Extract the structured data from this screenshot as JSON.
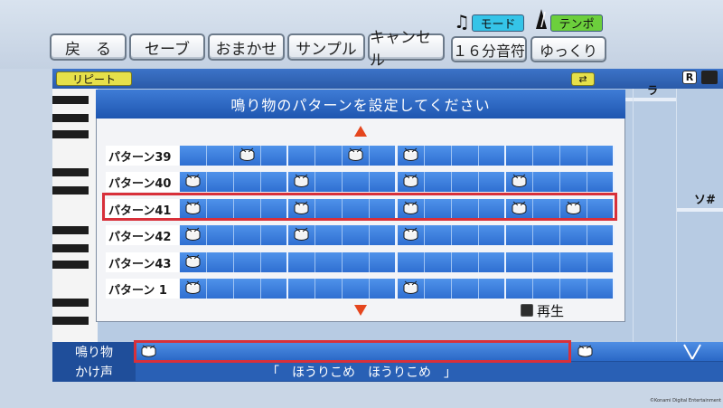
{
  "toolbar": {
    "back": "戻　る",
    "save": "セーブ",
    "omakase": "おまかせ",
    "sample": "サンプル",
    "cancel": "キャンセル",
    "note_length": "１６分音符",
    "speed": "ゆっくり",
    "mode_label": "モード",
    "tempo_label": "テンポ",
    "mode_icon": "music-note-icon",
    "tempo_icon": "metronome-icon"
  },
  "editor": {
    "repeat_label": "リピート",
    "loop_icon": "loop-icon",
    "r_badge": "R",
    "note_ra": "ラ",
    "note_sos": "ソ#"
  },
  "dialog": {
    "title": "鳴り物のパターンを設定してください",
    "play_label": "再生",
    "rows": [
      {
        "label": "パターン39",
        "beats": [
          2,
          6,
          8
        ]
      },
      {
        "label": "パターン40",
        "beats": [
          0,
          4,
          8,
          12
        ]
      },
      {
        "label": "パターン41",
        "beats": [
          0,
          4,
          8,
          12,
          14
        ],
        "selected": true
      },
      {
        "label": "パターン42",
        "beats": [
          0,
          4,
          8
        ]
      },
      {
        "label": "パターン43",
        "beats": [
          0
        ]
      },
      {
        "label": "パターン 1",
        "beats": [
          0,
          8
        ]
      }
    ],
    "columns": 16
  },
  "tracks": {
    "narimono_label": "鳴り物",
    "kakegoe_label": "かけ声",
    "lyric": "「　ほうりこめ　ほうりこめ　」"
  },
  "copyright": "©Konami Digital Entertainment",
  "colors": {
    "accent_blue": "#2f6fd1",
    "selection_red": "#d8303a",
    "mode_chip": "#35c4e8",
    "tempo_chip": "#6ccf3c",
    "repeat_chip": "#e6e04a"
  }
}
